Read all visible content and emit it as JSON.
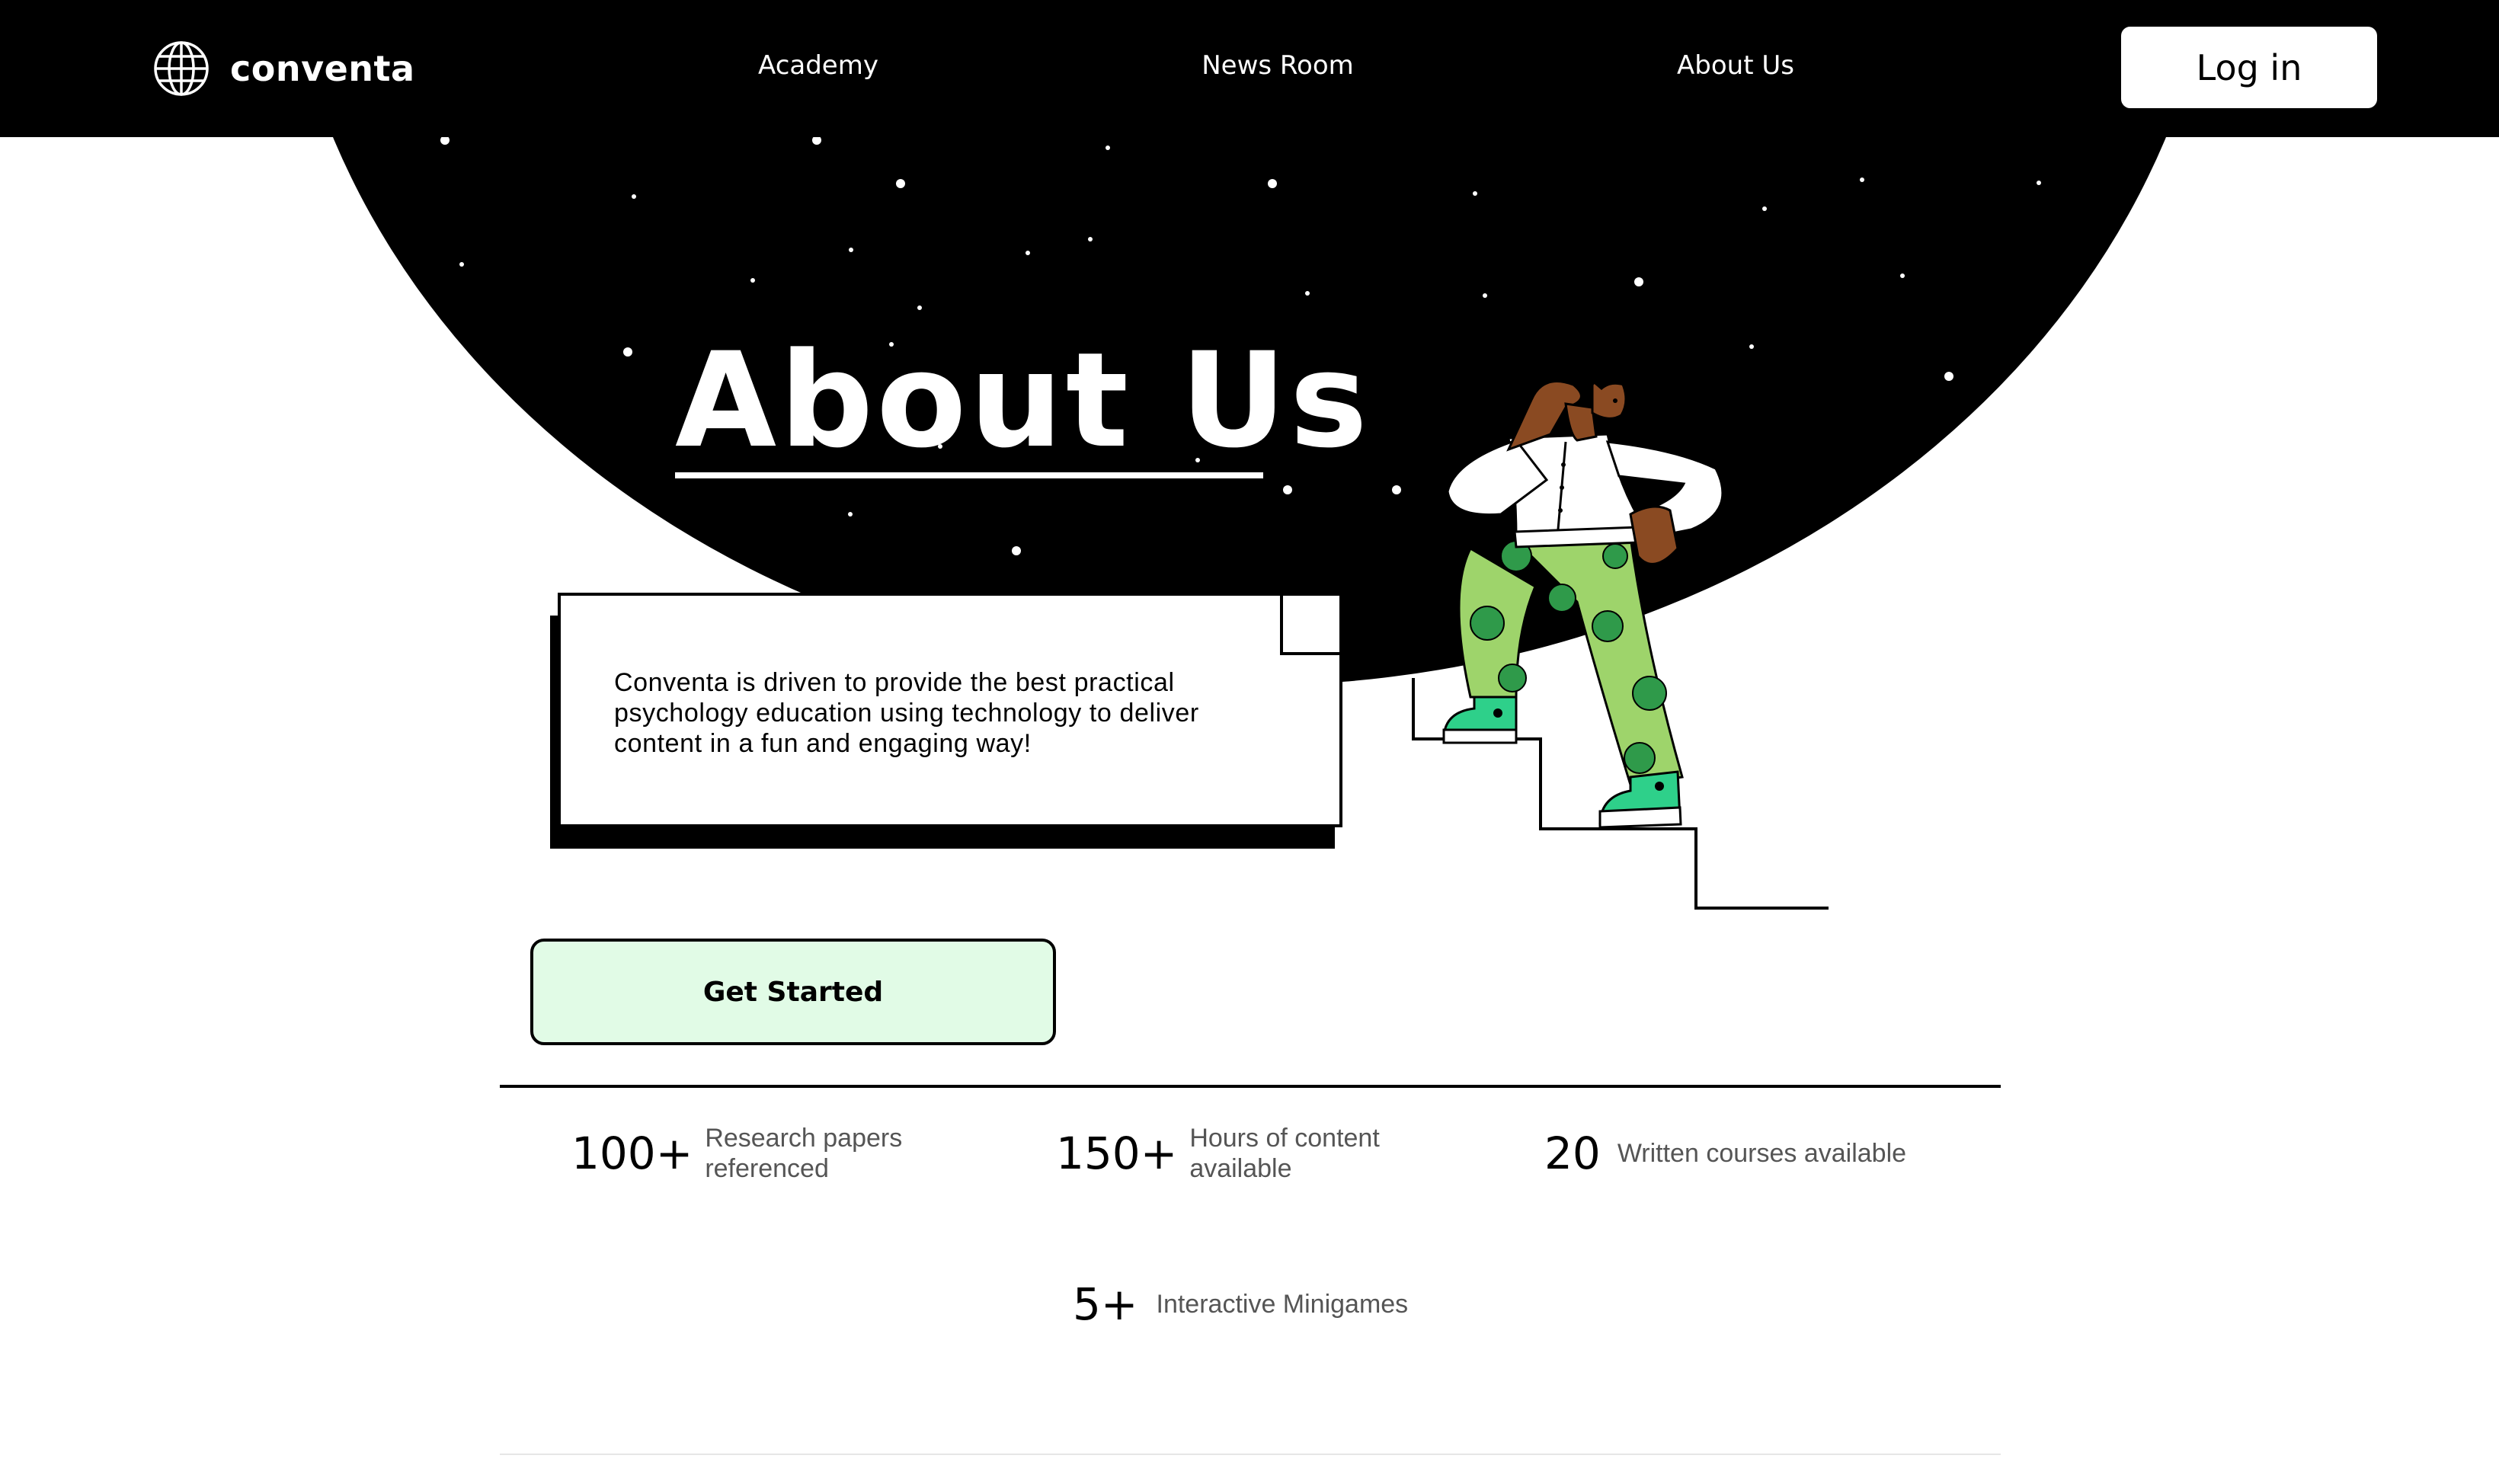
{
  "header": {
    "brand": "conventa",
    "nav": [
      "Academy",
      "News Room",
      "About Us"
    ],
    "login_label": "Log in"
  },
  "hero": {
    "title": "About Us",
    "description": "Conventa is driven to provide the best practical psychology education using technology to deliver content in a fun and engaging way!",
    "cta_label": "Get Started"
  },
  "stats": [
    {
      "value": "100+",
      "label_line1": "Research papers",
      "label_line2": "referenced"
    },
    {
      "value": "150+",
      "label_line1": "Hours of content",
      "label_line2": "available"
    },
    {
      "value": "20",
      "label_line1": "Written courses available",
      "label_line2": ""
    },
    {
      "value": "5+",
      "label_line1": "Interactive Minigames",
      "label_line2": ""
    }
  ],
  "colors": {
    "header_bg": "#000000",
    "sky": "#000000",
    "cta_bg": "#e1fbe6",
    "pants": "#9ed46b",
    "pants_dots": "#2f9a4a",
    "shoes": "#2ed08a",
    "skin": "#8a4a22"
  },
  "icons": {
    "brand": "globe-icon"
  }
}
